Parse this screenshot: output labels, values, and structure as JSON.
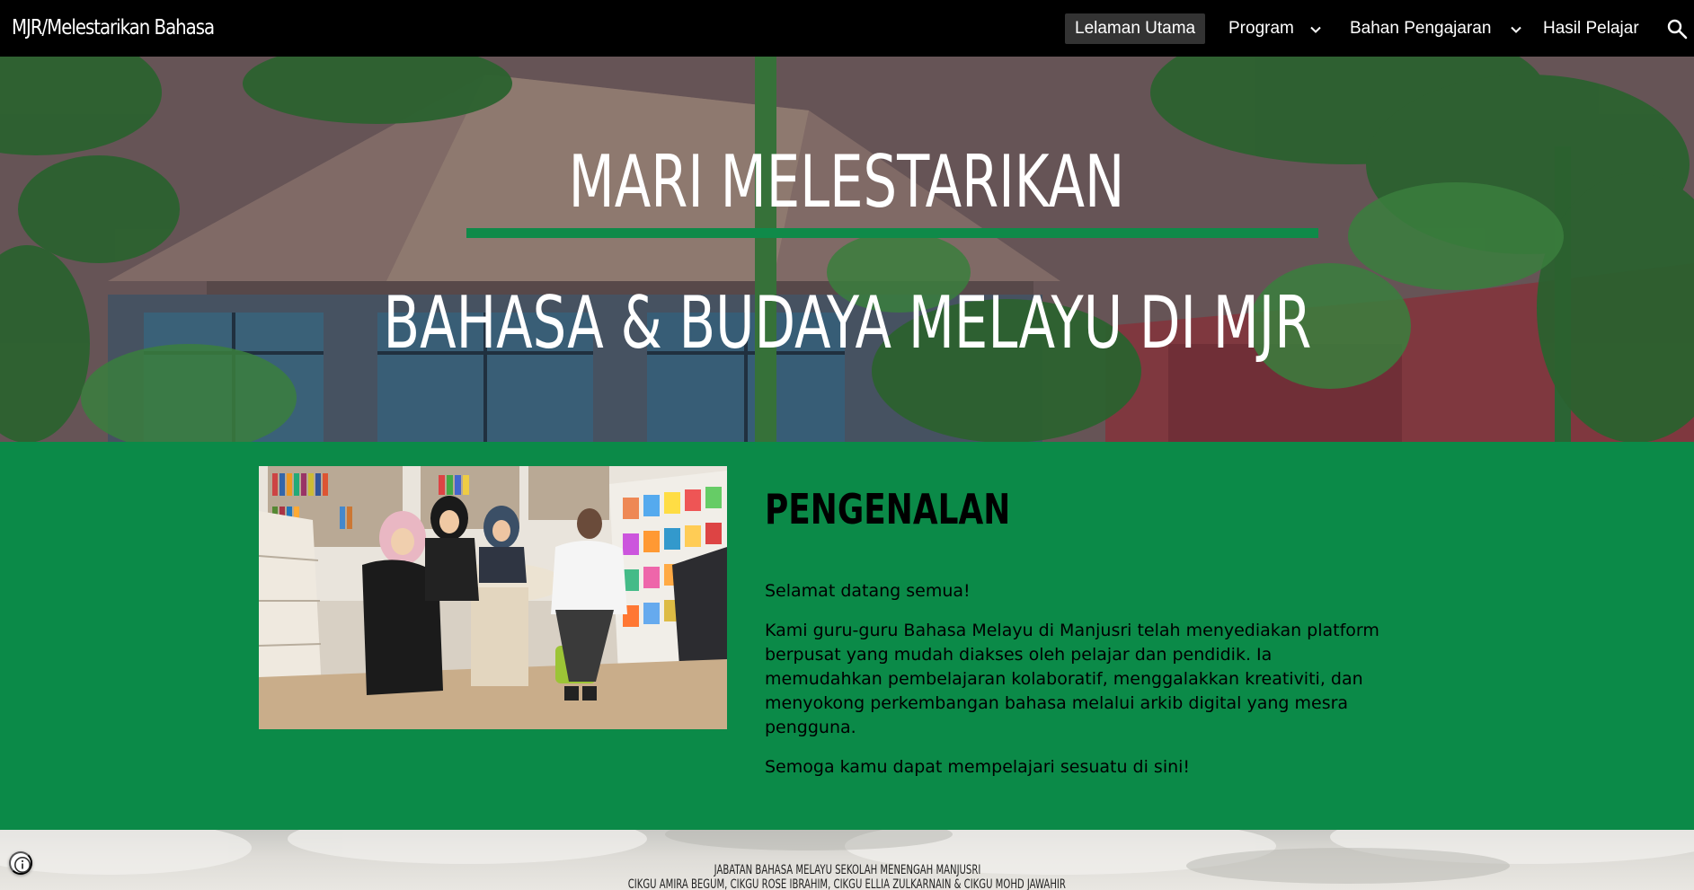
{
  "site": {
    "title": "MJR/Melestarikan Bahasa"
  },
  "nav": {
    "items": [
      {
        "label": "Lelaman Utama",
        "active": true,
        "has_dropdown": false
      },
      {
        "label": "Program",
        "active": false,
        "has_dropdown": true
      },
      {
        "label": "Bahan Pengajaran",
        "active": false,
        "has_dropdown": true
      },
      {
        "label": "Hasil Pelajar",
        "active": false,
        "has_dropdown": false
      }
    ],
    "search_icon": "search-icon"
  },
  "hero": {
    "line1": "MARI MELESTARIKAN",
    "line2": "BAHASA & BUDAYA MELAYU DI MJR",
    "divider_color": "#0f8a49",
    "overlay_tint": "#6e5d5f"
  },
  "intro": {
    "heading": "PENGENALAN",
    "paragraphs": [
      "Selamat datang semua!",
      "Kami guru-guru Bahasa Melayu di Manjusri telah menyediakan platform berpusat yang mudah diakses oleh pelajar dan pendidik. Ia memudahkan pembelajaran kolaboratif, menggalakkan kreativiti, dan menyokong perkembangan bahasa melalui arkib digital yang mesra pengguna.",
      "Semoga kamu dapat mempelajari sesuatu di sini!"
    ],
    "background_color": "#0b8a48"
  },
  "footer": {
    "line1": "JABATAN BAHASA MELAYU SEKOLAH MENENGAH MANJUSRI",
    "line2": "CIKGU AMIRA BEGUM, CIKGU ROSE IBRAHIM, CIKGU ELLIA ZULKARNAIN & CIKGU MOHD JAWAHIR",
    "info_icon": "info-icon"
  }
}
